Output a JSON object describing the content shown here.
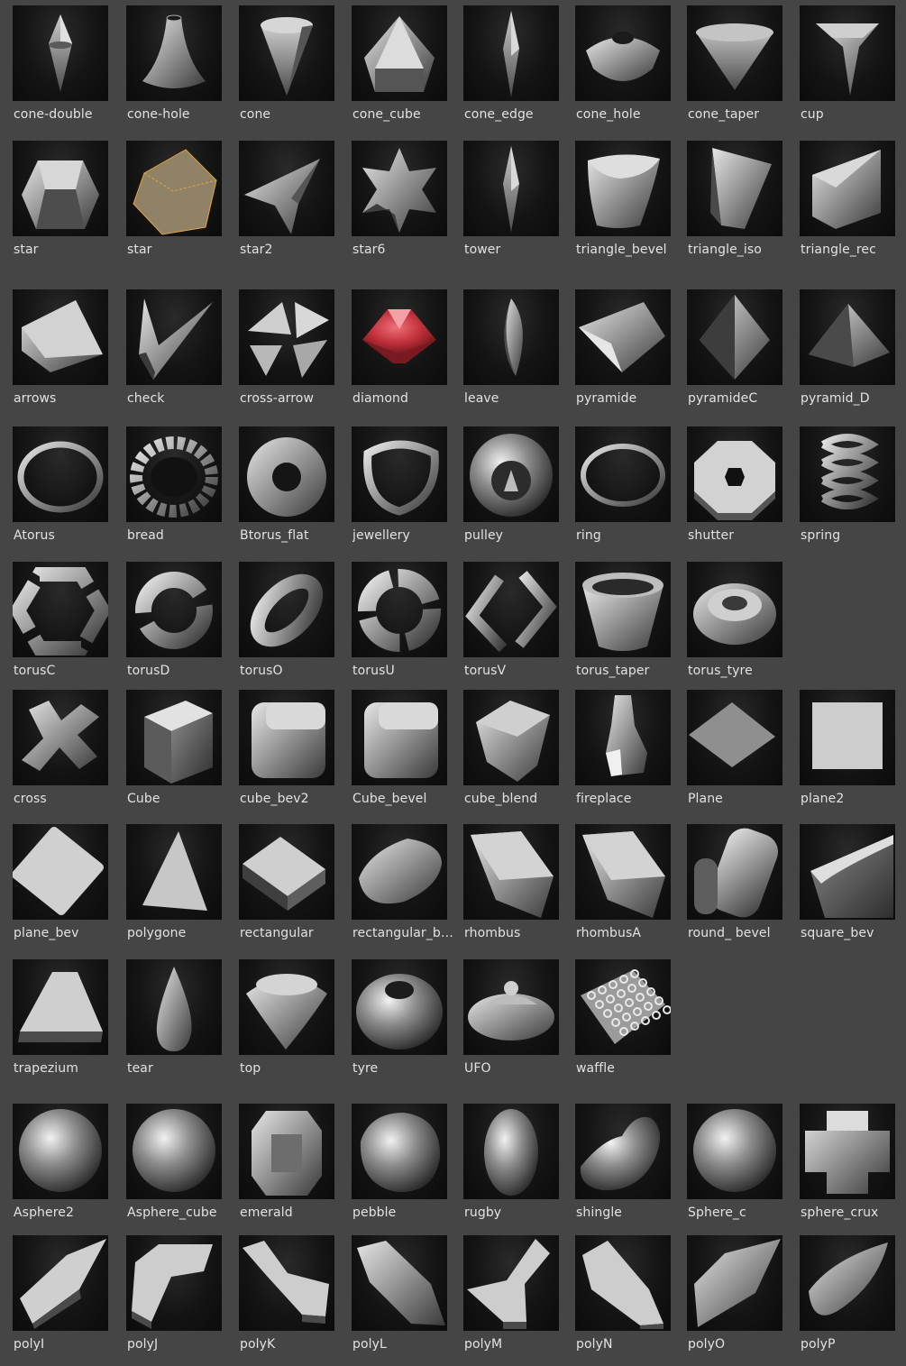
{
  "rows": [
    {
      "items": [
        {
          "label": "cone-double",
          "icon": "cone-double-icon",
          "shape": "doublecone"
        },
        {
          "label": "cone-hole",
          "icon": "cone-hole-icon",
          "shape": "bell"
        },
        {
          "label": "cone",
          "icon": "cone-icon",
          "shape": "cone"
        },
        {
          "label": "cone_cube",
          "icon": "cone-cube-icon",
          "shape": "conecube"
        },
        {
          "label": "cone_edge",
          "icon": "cone-edge-icon",
          "shape": "spike"
        },
        {
          "label": "cone_hole",
          "icon": "cone-hole-cup-icon",
          "shape": "donutcone"
        },
        {
          "label": "cone_taper",
          "icon": "cone-taper-icon",
          "shape": "funnel"
        },
        {
          "label": "cup",
          "icon": "cup-icon",
          "shape": "cup"
        }
      ]
    },
    {
      "items": [
        {
          "label": "star",
          "icon": "star-gem-icon",
          "shape": "gem"
        },
        {
          "label": "star",
          "icon": "star-wire-icon",
          "shape": "wirecube"
        },
        {
          "label": "star2",
          "icon": "star2-icon",
          "shape": "star3"
        },
        {
          "label": "star6",
          "icon": "star6-icon",
          "shape": "star6"
        },
        {
          "label": "tower",
          "icon": "tower-icon",
          "shape": "spike"
        },
        {
          "label": "triangle_bevel",
          "icon": "triangle-bevel-icon",
          "shape": "tribevel"
        },
        {
          "label": "triangle_iso",
          "icon": "triangle-iso-icon",
          "shape": "tribox"
        },
        {
          "label": "triangle_rec",
          "icon": "triangle-rec-icon",
          "shape": "trirec"
        }
      ]
    },
    {
      "items": [
        {
          "label": "arrows",
          "icon": "arrows-icon",
          "shape": "arrowplate"
        },
        {
          "label": "check",
          "icon": "check-icon",
          "shape": "check"
        },
        {
          "label": "cross-arrow",
          "icon": "cross-arrow-icon",
          "shape": "crossarrow"
        },
        {
          "label": "diamond",
          "icon": "diamond-icon",
          "shape": "diamond"
        },
        {
          "label": "leave",
          "icon": "leave-icon",
          "shape": "leaf"
        },
        {
          "label": "pyramide",
          "icon": "pyramide-icon",
          "shape": "pyramid"
        },
        {
          "label": "pyramideC",
          "icon": "pyramidec-icon",
          "shape": "pyramidc"
        },
        {
          "label": "pyramid_D",
          "icon": "pyramid-d-icon",
          "shape": "pyramidd"
        }
      ]
    },
    {
      "items": [
        {
          "label": "Atorus",
          "icon": "atorus-icon",
          "shape": "ring"
        },
        {
          "label": "bread",
          "icon": "bread-icon",
          "shape": "bread"
        },
        {
          "label": "Btorus_flat",
          "icon": "btorus-flat-icon",
          "shape": "flatdonut"
        },
        {
          "label": "jewellery",
          "icon": "jewellery-icon",
          "shape": "jewel"
        },
        {
          "label": "pulley",
          "icon": "pulley-icon",
          "shape": "pulley"
        },
        {
          "label": "ring",
          "icon": "ring-icon",
          "shape": "ringthin"
        },
        {
          "label": "shutter",
          "icon": "shutter-icon",
          "shape": "shutter"
        },
        {
          "label": "spring",
          "icon": "spring-icon",
          "shape": "spring"
        }
      ]
    },
    {
      "items": [
        {
          "label": "torusC",
          "icon": "torusc-icon",
          "shape": "hexring"
        },
        {
          "label": "torusD",
          "icon": "torusd-icon",
          "shape": "ringsplit"
        },
        {
          "label": "torusO",
          "icon": "toruso-icon",
          "shape": "ovalring"
        },
        {
          "label": "torusU",
          "icon": "torusu-icon",
          "shape": "ringseg"
        },
        {
          "label": "torusV",
          "icon": "torusv-icon",
          "shape": "vbrackets"
        },
        {
          "label": "torus_taper",
          "icon": "torus-taper-icon",
          "shape": "pot"
        },
        {
          "label": "torus_tyre",
          "icon": "torus-tyre-icon",
          "shape": "tyreflat"
        }
      ]
    },
    {
      "items": [
        {
          "label": "cross",
          "icon": "cross-icon",
          "shape": "cross"
        },
        {
          "label": "Cube",
          "icon": "cube-icon",
          "shape": "cube"
        },
        {
          "label": "cube_bev2",
          "icon": "cube-bev2-icon",
          "shape": "cuberound"
        },
        {
          "label": "Cube_bevel",
          "icon": "cube-bevel-icon",
          "shape": "cuberound"
        },
        {
          "label": "cube_blend",
          "icon": "cube-blend-icon",
          "shape": "cubeblend"
        },
        {
          "label": "fireplace",
          "icon": "fireplace-icon",
          "shape": "fireplace"
        },
        {
          "label": "Plane",
          "icon": "plane-icon",
          "shape": "planediamond"
        },
        {
          "label": "plane2",
          "icon": "plane2-icon",
          "shape": "planesquare"
        }
      ]
    },
    {
      "items": [
        {
          "label": "plane_bev",
          "icon": "plane-bev-icon",
          "shape": "planebev"
        },
        {
          "label": "polygone",
          "icon": "polygone-icon",
          "shape": "polygon"
        },
        {
          "label": "rectangular",
          "icon": "rectangular-icon",
          "shape": "slab"
        },
        {
          "label": "rectangular_be...",
          "icon": "rectangular-bevel-icon",
          "shape": "slabround"
        },
        {
          "label": "rhombus",
          "icon": "rhombus-icon",
          "shape": "rhombus"
        },
        {
          "label": "rhombusA",
          "icon": "rhombusa-icon",
          "shape": "rhombus"
        },
        {
          "label": "round_ bevel",
          "icon": "round-bevel-icon",
          "shape": "roundbev"
        },
        {
          "label": "square_bev",
          "icon": "square-bev-icon",
          "shape": "squarebev"
        }
      ]
    },
    {
      "items": [
        {
          "label": "trapezium",
          "icon": "trapezium-icon",
          "shape": "trapezium"
        },
        {
          "label": "tear",
          "icon": "tear-icon",
          "shape": "tear"
        },
        {
          "label": "top",
          "icon": "top-icon",
          "shape": "top"
        },
        {
          "label": "tyre",
          "icon": "tyre-icon",
          "shape": "tyre"
        },
        {
          "label": "UFO",
          "icon": "ufo-icon",
          "shape": "ufo"
        },
        {
          "label": "waffle",
          "icon": "waffle-icon",
          "shape": "waffle"
        }
      ]
    },
    {
      "items": [
        {
          "label": "Asphere2",
          "icon": "asphere2-icon",
          "shape": "sphere"
        },
        {
          "label": "Asphere_cube",
          "icon": "asphere-cube-icon",
          "shape": "sphere"
        },
        {
          "label": "emerald",
          "icon": "emerald-icon",
          "shape": "emerald"
        },
        {
          "label": "pebble",
          "icon": "pebble-icon",
          "shape": "pebble"
        },
        {
          "label": "rugby",
          "icon": "rugby-icon",
          "shape": "rugby"
        },
        {
          "label": "shingle",
          "icon": "shingle-icon",
          "shape": "shingle"
        },
        {
          "label": "Sphere_c",
          "icon": "sphere-c-icon",
          "shape": "sphere"
        },
        {
          "label": "sphere_crux",
          "icon": "sphere-crux-icon",
          "shape": "crux"
        }
      ]
    },
    {
      "items": [
        {
          "label": "polyI",
          "icon": "polyi-icon",
          "shape": "polyI"
        },
        {
          "label": "polyJ",
          "icon": "polyj-icon",
          "shape": "polyJ"
        },
        {
          "label": "polyK",
          "icon": "polyk-icon",
          "shape": "polyK"
        },
        {
          "label": "polyL",
          "icon": "polyl-icon",
          "shape": "polyL"
        },
        {
          "label": "polyM",
          "icon": "polym-icon",
          "shape": "polyM"
        },
        {
          "label": "polyN",
          "icon": "polyn-icon",
          "shape": "polyN"
        },
        {
          "label": "polyO",
          "icon": "polyo-icon",
          "shape": "polyO"
        },
        {
          "label": "polyP",
          "icon": "polyp-icon",
          "shape": "polyP"
        }
      ]
    }
  ],
  "colors": {
    "background": "#454545",
    "tile": "#141414",
    "label": "#e2e2e2",
    "metal_light": "#d9d9d9",
    "metal_mid": "#8c8c8c",
    "metal_dark": "#3d3d3d",
    "gem_red": "#c0303a"
  }
}
